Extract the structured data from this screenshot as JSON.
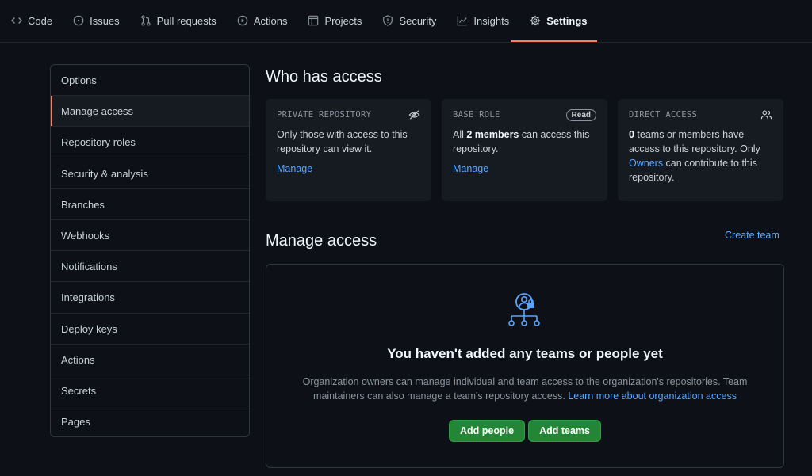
{
  "nav": {
    "tabs": [
      {
        "label": "Code",
        "icon": "code-icon"
      },
      {
        "label": "Issues",
        "icon": "issue-icon"
      },
      {
        "label": "Pull requests",
        "icon": "pull-request-icon"
      },
      {
        "label": "Actions",
        "icon": "play-icon"
      },
      {
        "label": "Projects",
        "icon": "project-icon"
      },
      {
        "label": "Security",
        "icon": "shield-icon"
      },
      {
        "label": "Insights",
        "icon": "graph-icon"
      },
      {
        "label": "Settings",
        "icon": "gear-icon"
      }
    ],
    "active": "Settings"
  },
  "sidebar": {
    "items": [
      "Options",
      "Manage access",
      "Repository roles",
      "Security & analysis",
      "Branches",
      "Webhooks",
      "Notifications",
      "Integrations",
      "Deploy keys",
      "Actions",
      "Secrets",
      "Pages"
    ],
    "selected": "Manage access"
  },
  "who_has_access": {
    "title": "Who has access",
    "cards": {
      "private": {
        "title": "PRIVATE REPOSITORY",
        "icon": "eye-closed-icon",
        "text": "Only those with access to this repository can view it.",
        "link": "Manage"
      },
      "base_role": {
        "title": "BASE ROLE",
        "badge": "Read",
        "text_pre": "All ",
        "text_bold": "2 members",
        "text_post": " can access this repository.",
        "link": "Manage"
      },
      "direct": {
        "title": "DIRECT ACCESS",
        "icon": "people-icon",
        "text_bold": "0",
        "text_mid": " teams or members have access to this repository. Only ",
        "text_link": "Owners",
        "text_post": " can contribute to this repository."
      }
    }
  },
  "manage_access": {
    "title": "Manage access",
    "create_team": "Create team",
    "empty": {
      "icon": "org-access-icon",
      "title": "You haven't added any teams or people yet",
      "desc": "Organization owners can manage individual and team access to the organization's repositories. Team maintainers can also manage a team's repository access. ",
      "learn_more": "Learn more about organization access",
      "add_people": "Add people",
      "add_teams": "Add teams"
    }
  },
  "colors": {
    "background": "#0d1117",
    "accent": "#f78166",
    "link": "#58a6ff",
    "button": "#238636"
  }
}
